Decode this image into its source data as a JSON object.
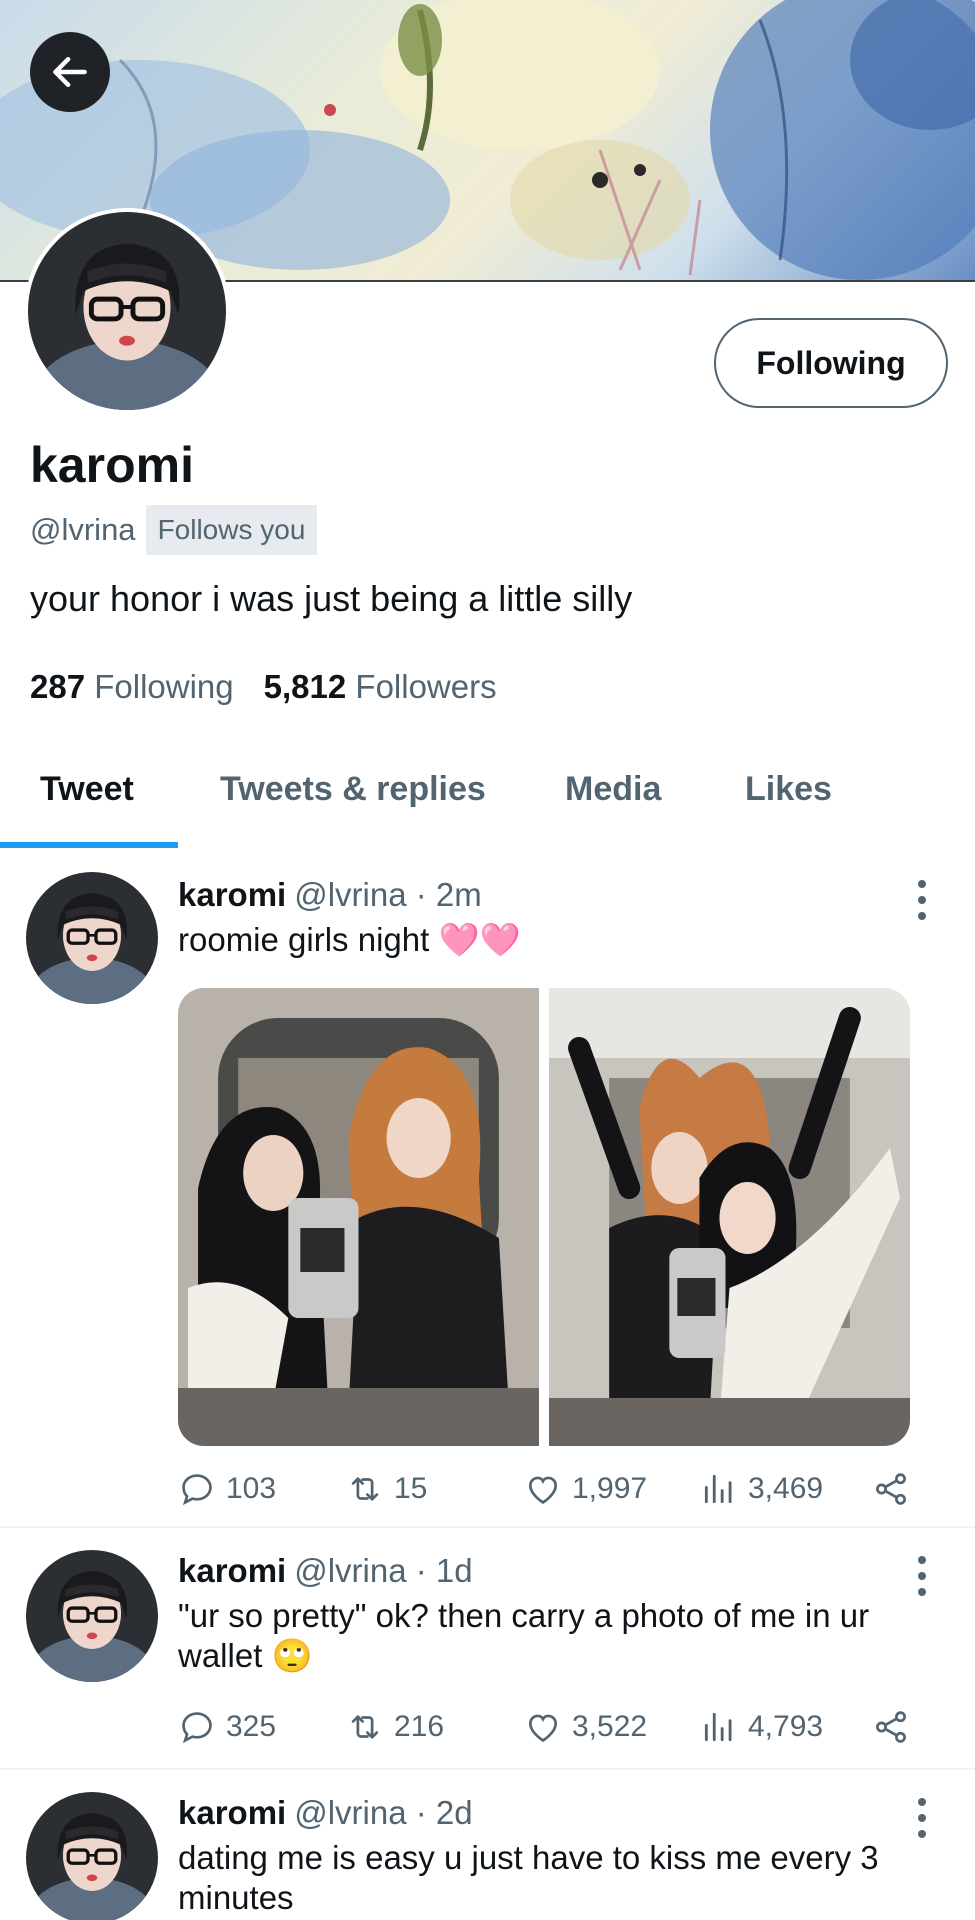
{
  "profile": {
    "display_name": "karomi",
    "handle": "@lvrina",
    "follows_you": "Follows you",
    "bio": "your honor i was just being a little silly",
    "follow_button": "Following",
    "following_count": "287",
    "following_label": "Following",
    "followers_count": "5,812",
    "followers_label": "Followers"
  },
  "tabs": [
    "Tweet",
    "Tweets & replies",
    "Media",
    "Likes"
  ],
  "tweets": [
    {
      "name": "karomi",
      "meta": "@lvrina · 2m",
      "text": "roomie girls night 🩷🩷",
      "replies": "103",
      "retweets": "15",
      "likes": "1,997",
      "views": "3,469"
    },
    {
      "name": "karomi",
      "meta": "@lvrina · 1d",
      "text": "\"ur so pretty\" ok? then carry a photo of me in ur wallet 🙄",
      "replies": "325",
      "retweets": "216",
      "likes": "3,522",
      "views": "4,793"
    },
    {
      "name": "karomi",
      "meta": "@lvrina · 2d",
      "text": "dating me is easy u just have to kiss me every 3 minutes"
    }
  ],
  "icons": {
    "back": "arrow-left-icon",
    "reply": "comment-icon",
    "retweet": "retweet-icon",
    "like": "heart-icon",
    "views": "bar-chart-icon",
    "share": "share-icon",
    "more": "more-vertical-icon"
  },
  "colors": {
    "accent": "#1d9bf0",
    "secondary_text": "#536471",
    "primary_text": "#0f1419"
  }
}
